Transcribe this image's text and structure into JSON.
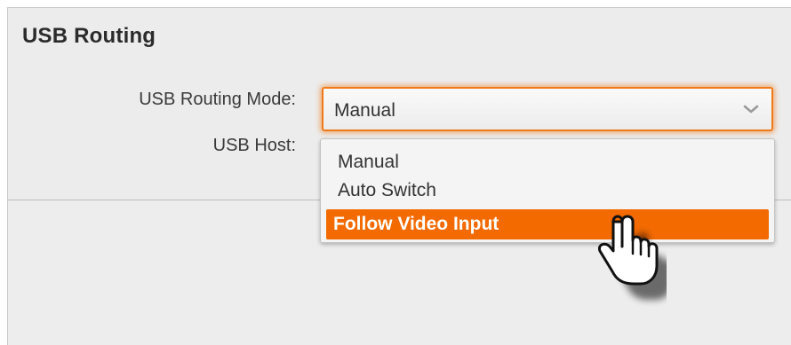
{
  "panel": {
    "title": "USB Routing"
  },
  "form": {
    "routing_mode_label": "USB Routing Mode:",
    "usb_host_label": "USB Host:",
    "routing_mode_value": "Manual"
  },
  "dropdown": {
    "options": [
      "Manual",
      "Auto Switch",
      "Follow Video Input"
    ],
    "highlighted_index": 2
  },
  "icons": {
    "select_chevron": "chevron-down-icon",
    "pointer": "hand-pointer-cursor-icon"
  },
  "colors": {
    "accent": "#f26a00",
    "focus_glow": "#f07a1a",
    "panel_bg": "#ececec"
  }
}
